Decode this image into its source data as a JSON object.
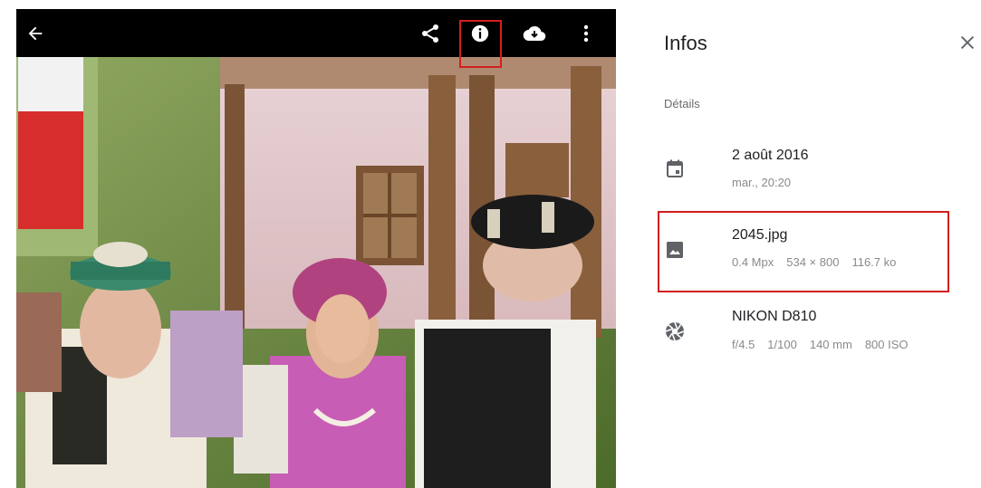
{
  "viewer": {
    "toolbar": {
      "back_icon": "arrow-left-icon",
      "share_icon": "share-icon",
      "info_icon": "info-icon",
      "download_icon": "cloud-download-icon",
      "more_icon": "more-vert-icon"
    },
    "highlight_color": "#d21f1f"
  },
  "panel": {
    "title": "Infos",
    "close_icon": "close-icon",
    "section_label": "Détails",
    "date": {
      "icon": "calendar-icon",
      "primary": "2 août 2016",
      "secondary": "mar., 20:20"
    },
    "file": {
      "icon": "image-icon",
      "name": "2045.jpg",
      "megapixels": "0.4 Mpx",
      "dimensions": "534 × 800",
      "size": "116.7 ko"
    },
    "camera": {
      "icon": "aperture-icon",
      "model": "NIKON D810",
      "aperture": "f/4.5",
      "shutter": "1/100",
      "focal": "140 mm",
      "iso": "800 ISO"
    }
  }
}
